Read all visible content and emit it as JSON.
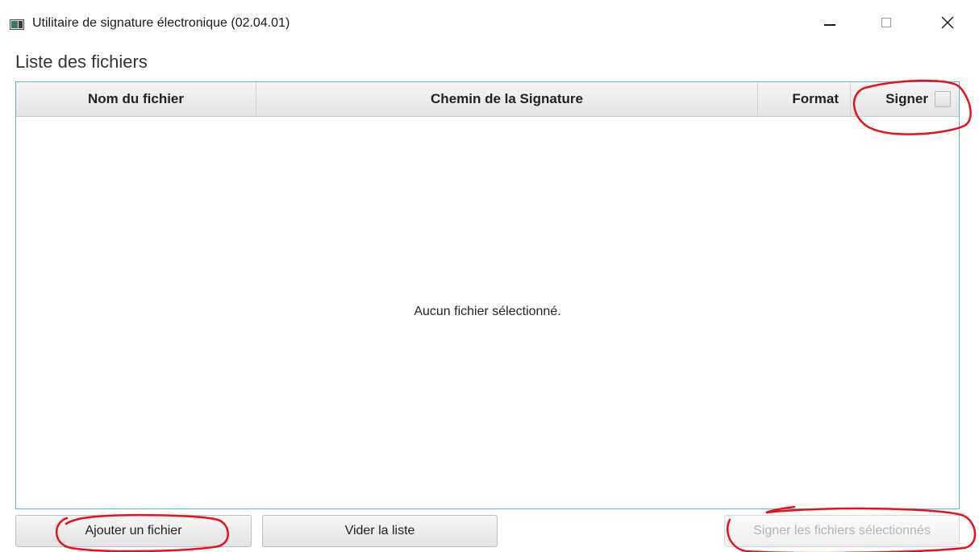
{
  "window": {
    "title": "Utilitaire de signature électronique (02.04.01)",
    "close_glyph": "✕"
  },
  "main": {
    "section_title": "Liste des fichiers",
    "table": {
      "columns": [
        "Nom du fichier",
        "Chemin de la Signature",
        "Format",
        "Signer"
      ],
      "empty_message": "Aucun fichier sélectionné."
    }
  },
  "actions": {
    "add_file": "Ajouter un fichier",
    "clear_list": "Vider la liste",
    "sign_selected": "Signer les fichiers sélectionnés",
    "sign_selected_enabled": false
  },
  "icons": {
    "app": "app-window-icon",
    "minimize": "minimize-icon",
    "maximize": "maximize-icon",
    "close": "close-icon"
  },
  "colors": {
    "table_border": "#58b5e0",
    "annotation": "#e8101c",
    "disabled_text": "#b4b4b4"
  }
}
